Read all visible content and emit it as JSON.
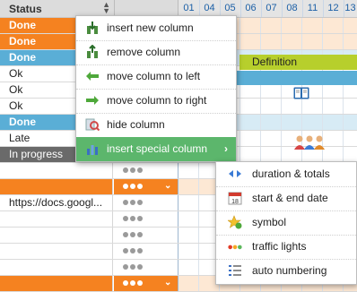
{
  "header": {
    "status_label": "Status",
    "days": [
      "01",
      "04",
      "05",
      "06",
      "07",
      "08",
      "11",
      "12",
      "13",
      "1"
    ]
  },
  "rows": [
    {
      "type": "group-orange",
      "label": "Done"
    },
    {
      "type": "group-orange",
      "label": "Done"
    },
    {
      "type": "group-blue",
      "label": "Done"
    },
    {
      "type": "plain",
      "label": "Ok"
    },
    {
      "type": "plain",
      "label": "Ok"
    },
    {
      "type": "plain",
      "label": "Ok"
    },
    {
      "type": "group-blue",
      "label": "Done"
    },
    {
      "type": "plain",
      "label": "Late"
    },
    {
      "type": "gray",
      "label": "In progress"
    },
    {
      "type": "plain",
      "label": ""
    },
    {
      "type": "group-orange",
      "label": ""
    },
    {
      "type": "plain",
      "label": "https://docs.googl..."
    },
    {
      "type": "plain",
      "label": ""
    },
    {
      "type": "plain",
      "label": ""
    },
    {
      "type": "plain",
      "label": ""
    },
    {
      "type": "plain",
      "label": ""
    },
    {
      "type": "group-orange",
      "label": ""
    }
  ],
  "timeline": {
    "definition_label": "Definition"
  },
  "context_menu": {
    "items": [
      {
        "label": "insert new column",
        "icon": "insert-column-icon"
      },
      {
        "label": "remove column",
        "icon": "remove-column-icon"
      },
      {
        "label": "move column to left",
        "icon": "arrow-left-icon"
      },
      {
        "label": "move column to right",
        "icon": "arrow-right-icon"
      },
      {
        "label": "hide column",
        "icon": "hide-column-icon"
      },
      {
        "label": "insert special column",
        "icon": "chart-icon",
        "active": true,
        "submenu_arrow": "›"
      }
    ]
  },
  "submenu": {
    "items": [
      {
        "label": "duration & totals",
        "icon": "duration-icon"
      },
      {
        "label": "start & end date",
        "icon": "calendar-icon"
      },
      {
        "label": "symbol",
        "icon": "star-icon"
      },
      {
        "label": "traffic lights",
        "icon": "traffic-lights-icon"
      },
      {
        "label": "auto numbering",
        "icon": "numbered-list-icon"
      }
    ]
  },
  "colors": {
    "orange": "#f58220",
    "blue": "#5aaed6",
    "green_active": "#5cb66c",
    "definition": "#b7cf2c",
    "tl_red": "#e23a26",
    "tl_orange": "#f5a623",
    "tl_green": "#5cb85c"
  }
}
